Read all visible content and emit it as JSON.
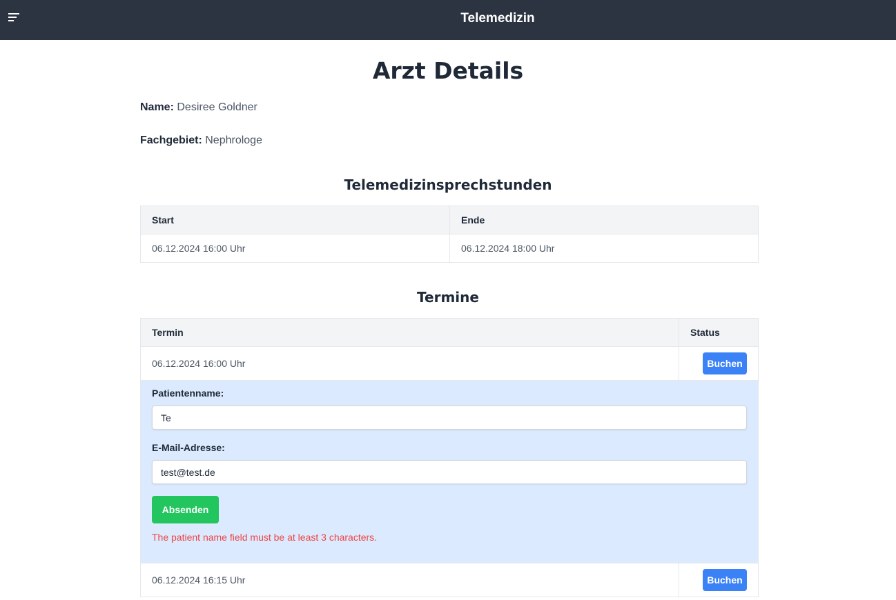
{
  "header": {
    "menu_icon": "menu-icon",
    "title": "Telemedizin"
  },
  "page": {
    "title": "Arzt Details"
  },
  "doctor": {
    "name_label": "Name:",
    "name": "Desiree Goldner",
    "specialty_label": "Fachgebiet:",
    "specialty": "Nephrologe"
  },
  "office_hours": {
    "title": "Telemedizinsprechstunden",
    "columns": [
      "Start",
      "Ende"
    ],
    "rows": [
      {
        "start": "06.12.2024 16:00 Uhr",
        "end": "06.12.2024 18:00 Uhr"
      }
    ]
  },
  "appointments": {
    "title": "Termine",
    "columns": [
      "Termin",
      "Status"
    ],
    "rows": [
      {
        "time": "06.12.2024 16:00 Uhr",
        "action": "Buchen"
      },
      {
        "time": "06.12.2024 16:15 Uhr",
        "action": "Buchen"
      }
    ],
    "form": {
      "patient_label": "Patientenname:",
      "patient_value": "Te",
      "email_label": "E-Mail-Adresse:",
      "email_value": "test@test.de",
      "submit_label": "Absenden",
      "error": "The patient name field must be at least 3 characters."
    }
  },
  "colors": {
    "topbar": "#2d3441",
    "primary": "#3b82f6",
    "success": "#22c55e",
    "error": "#ef4444",
    "form_bg": "#dbeafe"
  }
}
